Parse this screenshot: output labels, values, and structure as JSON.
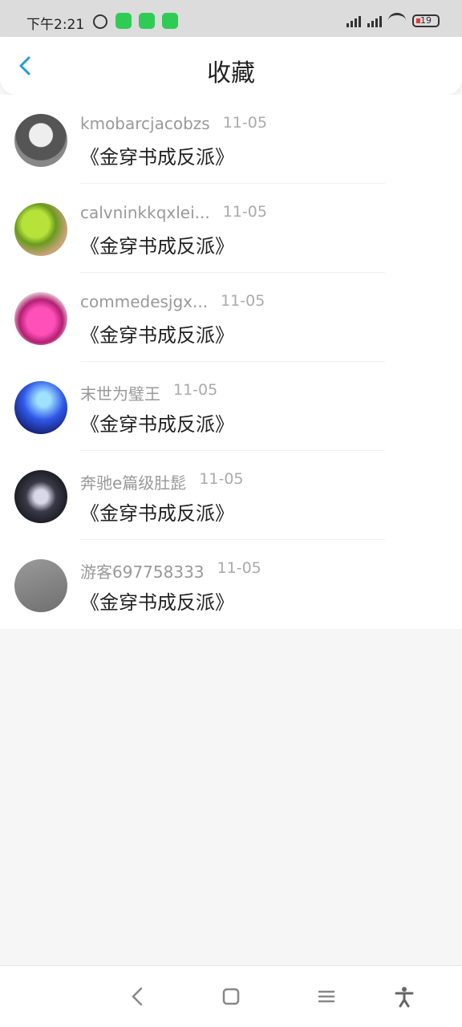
{
  "status_bar": {
    "time": "下午2:21",
    "battery": "19"
  },
  "header": {
    "title": "收藏"
  },
  "favorites": [
    {
      "username": "kmobarcjacobzs",
      "date": "11-05",
      "book": "《金穿书成反派》",
      "avatar_color": "#6b6b6b"
    },
    {
      "username": "calvninkkqxlei...",
      "date": "11-05",
      "book": "《金穿书成反派》",
      "avatar_color": "#7fbf2a"
    },
    {
      "username": "commedesjgx...",
      "date": "11-05",
      "book": "《金穿书成反派》",
      "avatar_color": "#e33aa0"
    },
    {
      "username": "末世为璧王",
      "date": "11-05",
      "book": "《金穿书成反派》",
      "avatar_color": "#2b3fd0"
    },
    {
      "username": "奔驰e篇级肚髭",
      "date": "11-05",
      "book": "《金穿书成反派》",
      "avatar_color": "#2f2f3a"
    },
    {
      "username": "游客697758333",
      "date": "11-05",
      "book": "《金穿书成反派》",
      "avatar_color": "#8c8c8c"
    }
  ],
  "colors": {
    "accent": "#1e9be0",
    "background": "#f7f6f7"
  }
}
